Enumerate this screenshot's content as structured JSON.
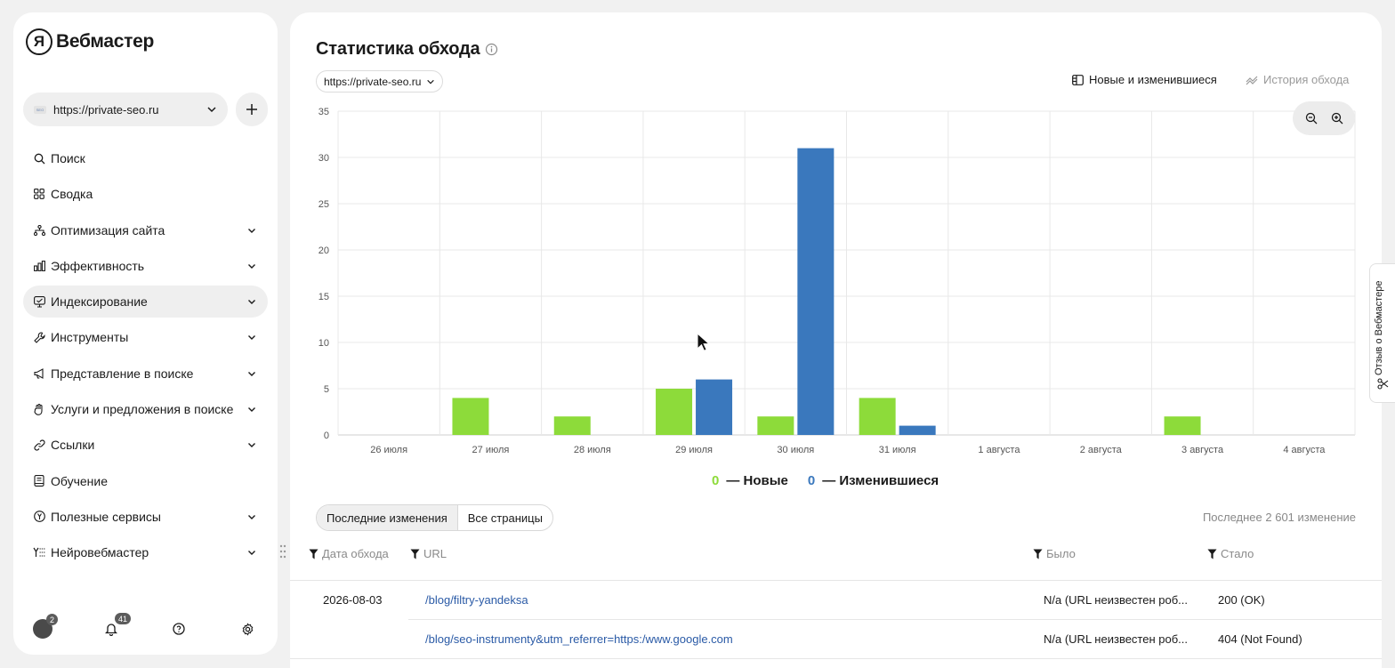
{
  "app": {
    "logo_letter": "Я",
    "logo_text": "Вебмастер"
  },
  "site_selector": {
    "value": "https://private-seo.ru",
    "favicon_text": "SEO"
  },
  "nav": [
    {
      "label": "Поиск",
      "icon": "search-icon",
      "has_chevron": false,
      "active": false
    },
    {
      "label": "Сводка",
      "icon": "grid-icon",
      "has_chevron": false,
      "active": false
    },
    {
      "label": "Оптимизация сайта",
      "icon": "sitemap-icon",
      "has_chevron": true,
      "active": false
    },
    {
      "label": "Эффективность",
      "icon": "bar-chart-icon",
      "has_chevron": true,
      "active": false
    },
    {
      "label": "Индексирование",
      "icon": "monitor-icon",
      "has_chevron": true,
      "active": true
    },
    {
      "label": "Инструменты",
      "icon": "wrench-icon",
      "has_chevron": true,
      "active": false
    },
    {
      "label": "Представление в поиске",
      "icon": "megaphone-icon",
      "has_chevron": true,
      "active": false
    },
    {
      "label": "Услуги и предложения в поиске",
      "icon": "hand-icon",
      "has_chevron": true,
      "active": false
    },
    {
      "label": "Ссылки",
      "icon": "link-icon",
      "has_chevron": true,
      "active": false
    },
    {
      "label": "Обучение",
      "icon": "book-icon",
      "has_chevron": false,
      "active": false
    },
    {
      "label": "Полезные сервисы",
      "icon": "yandex-icon",
      "has_chevron": true,
      "active": false
    },
    {
      "label": "Нейровебмастер",
      "icon": "ai-list-icon",
      "has_chevron": true,
      "active": false
    }
  ],
  "footer": {
    "avatar_badge": "2",
    "notifications_badge": "41"
  },
  "main": {
    "title": "Статистика обхода",
    "url_select": "https://private-seo.ru",
    "view_new_changed": "Новые и изменившиеся",
    "view_history": "История обхода"
  },
  "chart_data": {
    "type": "bar",
    "categories": [
      "26 июля",
      "27 июля",
      "28 июля",
      "29 июля",
      "30 июля",
      "31 июля",
      "1 августа",
      "2 августа",
      "3 августа",
      "4 августа"
    ],
    "series": [
      {
        "name": "Новые",
        "color": "#8ddb3a",
        "values": [
          0,
          4,
          2,
          5,
          2,
          4,
          0,
          0,
          2,
          0
        ]
      },
      {
        "name": "Изменившиеся",
        "color": "#3a78bd",
        "values": [
          0,
          0,
          0,
          6,
          31,
          1,
          0,
          0,
          0,
          0
        ]
      }
    ],
    "yticks": [
      0,
      5,
      10,
      15,
      20,
      25,
      30,
      35
    ],
    "ylim": [
      0,
      35
    ],
    "grid": true,
    "legend_position": "bottom"
  },
  "legend": {
    "new_count": "0",
    "new_label": "— Новые",
    "changed_count": "0",
    "changed_label": "— Изменившиеся"
  },
  "tabs": {
    "recent": "Последние изменения",
    "all": "Все страницы"
  },
  "count_text": "Последнее 2 601 изменение",
  "table": {
    "headers": {
      "date": "Дата обхода",
      "url": "URL",
      "was": "Было",
      "now": "Стало"
    },
    "rows": [
      {
        "date": "2026-08-03",
        "url": "/blog/filtry-yandeksa",
        "was": "N/a (URL неизвестен роб...",
        "now": "200 (OK)"
      },
      {
        "date": "",
        "url": "/blog/seo-instrumenty&utm_referrer=https:/www.google.com",
        "was": "N/a (URL неизвестен роб...",
        "now": "404 (Not Found)"
      }
    ]
  },
  "feedback": {
    "label": "Отзыв о Вебмастере"
  }
}
